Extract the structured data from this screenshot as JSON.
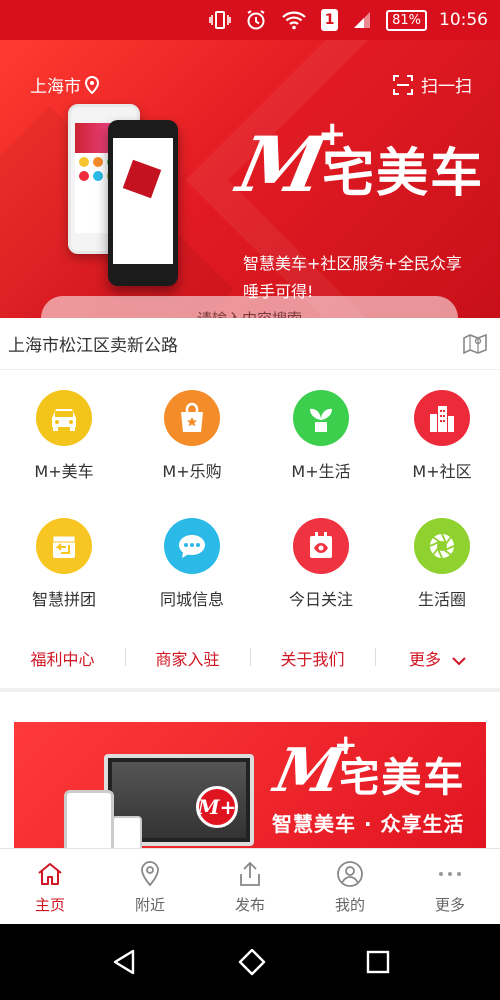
{
  "status_bar": {
    "battery": "81%",
    "time": "10:56",
    "sim": "1"
  },
  "hero": {
    "city": "上海市",
    "scan_label": "扫一扫",
    "logo_m": "M",
    "logo_plus": "+",
    "logo_cn": "宅美车",
    "slogan_line1": "智慧美车+社区服务+全民众享",
    "slogan_line2": "唾手可得!",
    "search_placeholder": "请输入内容搜索"
  },
  "address": {
    "text": "上海市松江区卖新公路"
  },
  "features": [
    {
      "label": "M+美车",
      "icon": "car-icon",
      "color": "#f3c41a"
    },
    {
      "label": "M+乐购",
      "icon": "shopping-bag-icon",
      "color": "#f58c2a"
    },
    {
      "label": "M+生活",
      "icon": "plant-icon",
      "color": "#3ccf4e"
    },
    {
      "label": "M+社区",
      "icon": "building-icon",
      "color": "#ec2a3a"
    },
    {
      "label": "智慧拼团",
      "icon": "group-buy-icon",
      "color": "#f8c623"
    },
    {
      "label": "同城信息",
      "icon": "chat-icon",
      "color": "#2bb9e8"
    },
    {
      "label": "今日关注",
      "icon": "calendar-eye-icon",
      "color": "#ef3340"
    },
    {
      "label": "生活圈",
      "icon": "aperture-icon",
      "color": "#8fd12e"
    }
  ],
  "links": [
    {
      "label": "福利中心"
    },
    {
      "label": "商家入驻"
    },
    {
      "label": "关于我们"
    },
    {
      "label": "更多"
    }
  ],
  "banner": {
    "logo_m": "M",
    "logo_plus": "+",
    "logo_cn": "宅美车",
    "slogan": "智慧美车 · 众享生活",
    "badge": "M+"
  },
  "tabs": [
    {
      "label": "主页",
      "icon": "home-icon",
      "active": true
    },
    {
      "label": "附近",
      "icon": "location-icon"
    },
    {
      "label": "发布",
      "icon": "share-icon"
    },
    {
      "label": "我的",
      "icon": "user-icon"
    },
    {
      "label": "更多",
      "icon": "more-icon"
    }
  ],
  "colors": {
    "brand_red": "#d8101e",
    "link_red": "#d01523"
  }
}
